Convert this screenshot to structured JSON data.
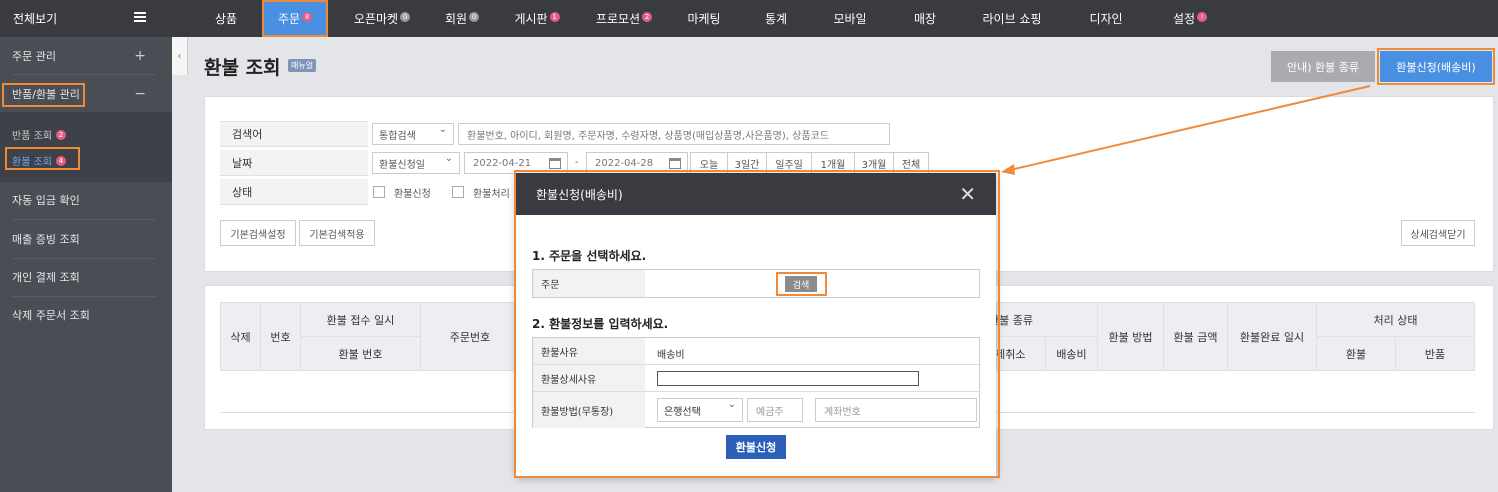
{
  "topbar": {
    "allview": "전체보기",
    "menus": [
      {
        "label": "상품",
        "badge": ""
      },
      {
        "label": "주문",
        "badge": "8"
      },
      {
        "label": "오픈마켓",
        "badge": "0"
      },
      {
        "label": "회원",
        "badge": "0"
      },
      {
        "label": "게시판",
        "badge": "1"
      },
      {
        "label": "프로모션",
        "badge": "2"
      },
      {
        "label": "마케팅",
        "badge": ""
      },
      {
        "label": "통계",
        "badge": ""
      },
      {
        "label": "모바일",
        "badge": ""
      },
      {
        "label": "매장",
        "badge": ""
      },
      {
        "label": "라이브 쇼핑",
        "badge": ""
      },
      {
        "label": "디자인",
        "badge": ""
      },
      {
        "label": "설정",
        "badge": "!"
      }
    ]
  },
  "sidebar": {
    "items": [
      {
        "label": "주문 관리",
        "toggle": "+"
      },
      {
        "label": "반품/환불 관리",
        "toggle": "−"
      }
    ],
    "sub": [
      {
        "label": "반품 조회",
        "badge": "2"
      },
      {
        "label": "환불 조회",
        "badge": "4"
      }
    ],
    "more": [
      "자동 입금 확인",
      "매출 증빙 조회",
      "개인 결제 조회",
      "삭제 주문서 조회"
    ]
  },
  "page": {
    "title": "환불 조회",
    "manual": "매뉴얼",
    "btn_guide": "안내) 환불 종류",
    "btn_apply": "환불신청(배송비)"
  },
  "search": {
    "labels": [
      "검색어",
      "날짜",
      "상태"
    ],
    "type_select": "통합검색",
    "keyword_placeholder": "환불번호, 아이디, 회원명, 주문자명, 수령자명, 상품명(매입상품명,사은품명), 상품코드",
    "date_select": "환불신청일",
    "date_from": "2022-04-21",
    "date_sep": "-",
    "date_to": "2022-04-28",
    "quick": [
      "오늘",
      "3일간",
      "일주일",
      "1개월",
      "3개월",
      "전체"
    ],
    "status": [
      "환불신청",
      "환불처리"
    ],
    "btn_default_set": "기본검색설정",
    "btn_default_apply": "기본검색적용",
    "btn_detail_close": "상세검색닫기"
  },
  "table": {
    "headers": {
      "delete": "삭제",
      "no": "번호",
      "date": "환불 접수 일시",
      "refund_no": "환불 번호",
      "order_no": "주문번호",
      "type": "환불 종류",
      "cancel": "결제취소",
      "shipping": "배송비",
      "method": "환불 방법",
      "amount": "환불 금액",
      "complete": "환불완료 일시",
      "status": "처리 상태",
      "refund": "환불",
      "return": "반품"
    }
  },
  "modal": {
    "title": "환불신청(배송비)",
    "close": "✕",
    "step1": "1. 주문을 선택하세요.",
    "order_label": "주문",
    "search_btn": "검색",
    "step2": "2. 환불정보를 입력하세요.",
    "reason_label": "환불사유",
    "reason_value": "배송비",
    "detail_label": "환불상세사유",
    "method_label": "환불방법(무통장)",
    "bank_select": "은행선택",
    "holder_placeholder": "예금주",
    "account_placeholder": "계좌번호",
    "submit": "환불신청"
  }
}
